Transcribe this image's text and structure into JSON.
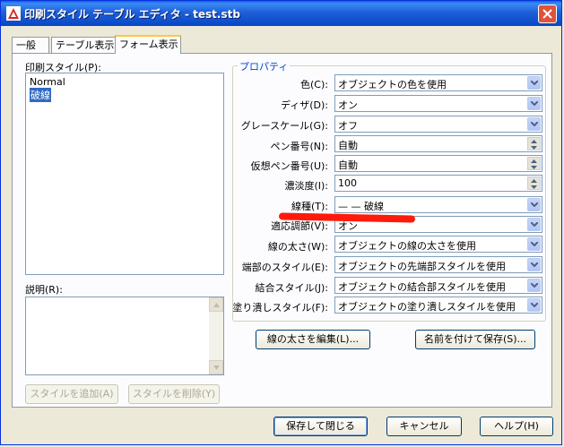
{
  "window": {
    "title": "印刷スタイル テーブル エディタ - test.stb"
  },
  "tabs": [
    {
      "label": "一般"
    },
    {
      "label": "テーブル表示"
    },
    {
      "label": "フォーム表示"
    }
  ],
  "left": {
    "styles_label": "印刷スタイル(P):",
    "styles": [
      "Normal",
      "破線"
    ],
    "description_label": "説明(R):",
    "description": "",
    "add_style_button": "スタイルを追加(A)",
    "delete_style_button": "スタイルを削除(Y)"
  },
  "properties": {
    "group_title": "プロパティ",
    "rows": [
      {
        "label": "色(C):",
        "value": "オブジェクトの色を使用"
      },
      {
        "label": "ディザ(D):",
        "value": "オン"
      },
      {
        "label": "グレースケール(G):",
        "value": "オフ"
      },
      {
        "label": "ペン番号(N):",
        "value": "自動"
      },
      {
        "label": "仮想ペン番号(U):",
        "value": "自動"
      },
      {
        "label": "濃淡度(I):",
        "value": "100"
      },
      {
        "label": "線種(T):",
        "value": "—  —   破線"
      },
      {
        "label": "適応調節(V):",
        "value": "オン"
      },
      {
        "label": "線の太さ(W):",
        "value": "オブジェクトの線の太さを使用"
      },
      {
        "label": "端部のスタイル(E):",
        "value": "オブジェクトの先端部スタイルを使用"
      },
      {
        "label": "結合スタイル(J):",
        "value": "オブジェクトの結合部スタイルを使用"
      },
      {
        "label": "塗り潰しスタイル(F):",
        "value": "オブジェクトの塗り潰しスタイルを使用"
      }
    ],
    "edit_lineweights_button": "線の太さを編集(L)...",
    "save_as_button": "名前を付けて保存(S)..."
  },
  "footer": {
    "save_close_button": "保存して閉じる",
    "cancel_button": "キャンセル",
    "help_button": "ヘルプ(H)"
  },
  "colors": {
    "title_bar": "#0a5fe8",
    "group_title": "#0046d5",
    "selection": "#316ac5",
    "annotation_stroke": "#ff1a0a"
  },
  "icons": {
    "title": "autocad-icon",
    "close": "close-icon",
    "dropdown": "chevron-down-icon",
    "spin": "spin-arrows-icon"
  }
}
